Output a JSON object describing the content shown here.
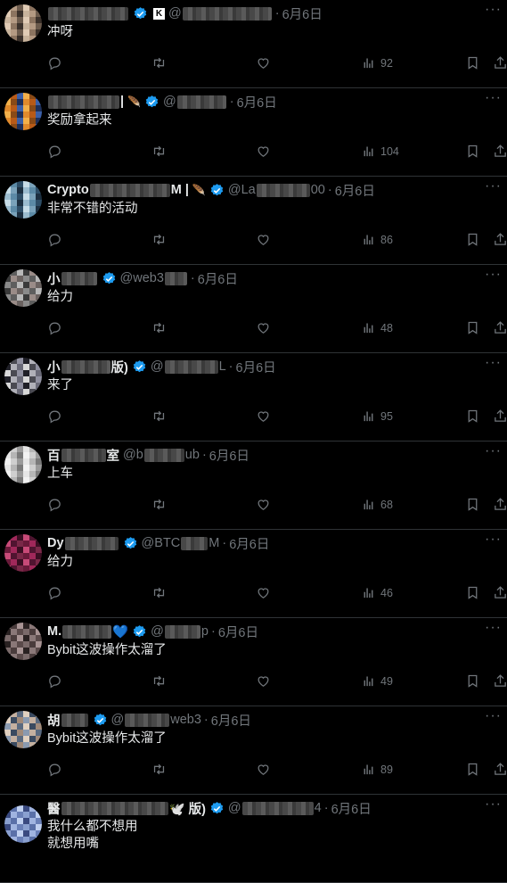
{
  "accent_color": "#1d9bf0",
  "tweets": [
    {
      "name_visible": "",
      "name_tail": "",
      "badge": "K",
      "handle": "@",
      "date": "6月6日",
      "text": "冲呀",
      "views": "92",
      "avatar": [
        "#c8b39c",
        "#b49a83",
        "#6b5a4c",
        "#e0cbb5",
        "#8c7460",
        "#3a302a"
      ]
    },
    {
      "name_visible": "",
      "name_tail": "|",
      "badge": "feather",
      "handle": "@",
      "date": "6月6日",
      "text": "奖励拿起来",
      "views": "104",
      "avatar": [
        "#e08a2c",
        "#b85a18",
        "#3b5fa8",
        "#f3b04a",
        "#8a4a16",
        "#1d2f5a"
      ]
    },
    {
      "name_visible": "Crypto",
      "name_tail": "M |",
      "badge": "feather",
      "handle": "@La",
      "handle_tail": "00",
      "date": "6月6日",
      "text": "非常不错的活动",
      "views": "86",
      "avatar": [
        "#9bbccf",
        "#5c8aa6",
        "#2d4d66",
        "#c7dde8",
        "#7aa2ba",
        "#1c2f40"
      ]
    },
    {
      "name_visible": "小",
      "name_tail": "",
      "badge": "",
      "handle": "@web3",
      "date": "6月6日",
      "text": "给力",
      "views": "48",
      "avatar": [
        "#8a8a8a",
        "#5e5e5e",
        "#b8b8b8",
        "#3a3a3a",
        "#9a8c88",
        "#6a6260"
      ]
    },
    {
      "name_visible": "小",
      "name_tail": "版)",
      "badge": "",
      "handle": "@",
      "handle_tail": "L",
      "date": "6月6日",
      "text": "来了",
      "views": "95",
      "avatar": [
        "#d8d8d8",
        "#4a4a52",
        "#9090a0",
        "#202028",
        "#b0b0b8",
        "#6a6a78"
      ]
    },
    {
      "name_visible": "百",
      "name_tail": "室",
      "badge": "",
      "handle": "@b",
      "handle_tail": "ub",
      "date": "6月6日",
      "text": "上车",
      "views": "68",
      "avatar": [
        "#f2f2f2",
        "#cfcfcf",
        "#9a9a9a",
        "#e6e6e6",
        "#b5b5b5",
        "#7a7a7a"
      ]
    },
    {
      "name_visible": "Dy",
      "name_tail": "",
      "badge": "",
      "handle": "@BTC",
      "handle_tail": "M",
      "date": "6月6日",
      "text": "给力",
      "views": "46",
      "avatar": [
        "#6a1a3a",
        "#a0285a",
        "#3a0e22",
        "#c84a78",
        "#501430",
        "#7a2848"
      ]
    },
    {
      "name_visible": "M.",
      "name_tail": "💙",
      "badge": "",
      "handle": "@",
      "handle_tail": "p",
      "date": "6月6日",
      "text": "Bybit这波操作太溜了",
      "views": "49",
      "avatar": [
        "#7a6a6a",
        "#4a3c3c",
        "#a89494",
        "#2a2222",
        "#8a7878",
        "#5a4a4a"
      ]
    },
    {
      "name_visible": "胡",
      "name_tail": "",
      "badge": "",
      "handle": "@",
      "handle_tail": "web3",
      "date": "6月6日",
      "text": "Bybit这波操作太溜了",
      "views": "89",
      "avatar": [
        "#8a9ab0",
        "#c4b0a0",
        "#5a6a80",
        "#e0d0c0",
        "#3a4a60",
        "#a08a7a"
      ]
    },
    {
      "name_visible": "醫",
      "name_tail": "🕊️ 版)",
      "badge": "",
      "handle": "@",
      "handle_tail": "4",
      "date": "6月6日",
      "text": "我什么都不想用\n就想用嘴",
      "views": "",
      "avatar": [
        "#8aa0d0",
        "#5a70a8",
        "#c0d0f0",
        "#3a4a80",
        "#a0b4e0",
        "#6a80b8"
      ]
    }
  ]
}
